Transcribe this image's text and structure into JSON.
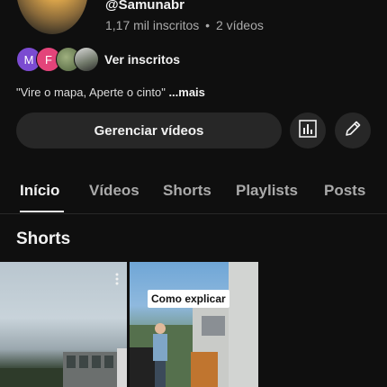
{
  "channel": {
    "handle": "@Samunabr",
    "subscribers": "1,17 mil inscritos",
    "separator": "•",
    "videos": "2 vídeos",
    "description": "\"Vire o mapa, Aperte o cinto\"",
    "more_label": "...mais"
  },
  "subscribers_preview": {
    "avatars": [
      {
        "letter": "M",
        "color": "#7b4bd1"
      },
      {
        "letter": "F",
        "color": "#e3447a"
      },
      {
        "letter": "",
        "icon": "profile-photo"
      },
      {
        "letter": "",
        "icon": "profile-photo"
      }
    ],
    "label": "Ver inscritos"
  },
  "actions": {
    "manage_label": "Gerenciar vídeos",
    "analytics_icon": "bar-chart-icon",
    "edit_icon": "pencil-icon"
  },
  "tabs": [
    {
      "label": "Início",
      "active": true
    },
    {
      "label": "Vídeos",
      "active": false
    },
    {
      "label": "Shorts",
      "active": false
    },
    {
      "label": "Playlists",
      "active": false
    },
    {
      "label": "Posts",
      "active": false
    }
  ],
  "shorts_section": {
    "title": "Shorts",
    "items": [
      {
        "caption": "",
        "menu_icon": "more-vert-icon"
      },
      {
        "caption": "Como explicar"
      }
    ]
  }
}
